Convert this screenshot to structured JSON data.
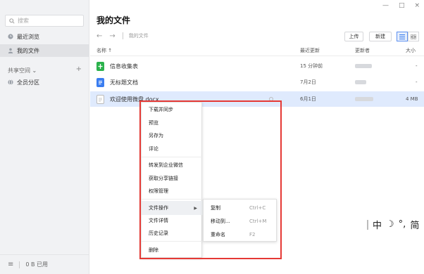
{
  "sidebar": {
    "search_placeholder": "搜索",
    "items": [
      {
        "label": "最近浏览",
        "icon": "clock-icon"
      },
      {
        "label": "我的文件",
        "icon": "person-icon",
        "active": true
      }
    ],
    "section_label": "共享空间 ⌄",
    "section_add": "+",
    "section_items": [
      {
        "label": "全员分区",
        "icon": "globe-icon"
      }
    ],
    "footer_menu": "≡",
    "footer_usage": "0 B 已用"
  },
  "window": {
    "minimize": "—",
    "maximize": "□",
    "close": "×"
  },
  "main": {
    "title": "我的文件",
    "breadcrumb": "我的文件",
    "upload_label": "上传",
    "new_label": "新建",
    "columns": {
      "name": "名称 ↑",
      "updated": "最近更新",
      "updater": "更新者",
      "size": "大小"
    },
    "rows": [
      {
        "name": "信息收集表",
        "updated": "15 分钟前",
        "size": "-",
        "icon": "sheet-icon"
      },
      {
        "name": "无标题文档",
        "updated": "7月2日",
        "size": "-",
        "icon": "doc-icon"
      },
      {
        "name": "欢迎使用微盘.docx",
        "updated": "6月1日",
        "size": "4 MB",
        "icon": "file-icon",
        "selected": true
      }
    ]
  },
  "context_menu": {
    "items": [
      "下载并同步",
      "预览",
      "另存为",
      "评论",
      "转发到企业微信",
      "获取分享链接",
      "权限管理",
      "文件操作",
      "文件详情",
      "历史记录",
      "删除"
    ],
    "submenu_arrow": "▶",
    "submenu": [
      {
        "label": "复制",
        "shortcut": "Ctrl+C"
      },
      {
        "label": "移动到...",
        "shortcut": "Ctrl+M"
      },
      {
        "label": "重命名",
        "shortcut": "F2"
      }
    ]
  },
  "ime": {
    "chars": [
      "中",
      "☽",
      "°,",
      "简"
    ]
  },
  "colors": {
    "accent": "#3a7df0",
    "highlight_border": "#e53935",
    "selected_row": "#dfeafd"
  }
}
